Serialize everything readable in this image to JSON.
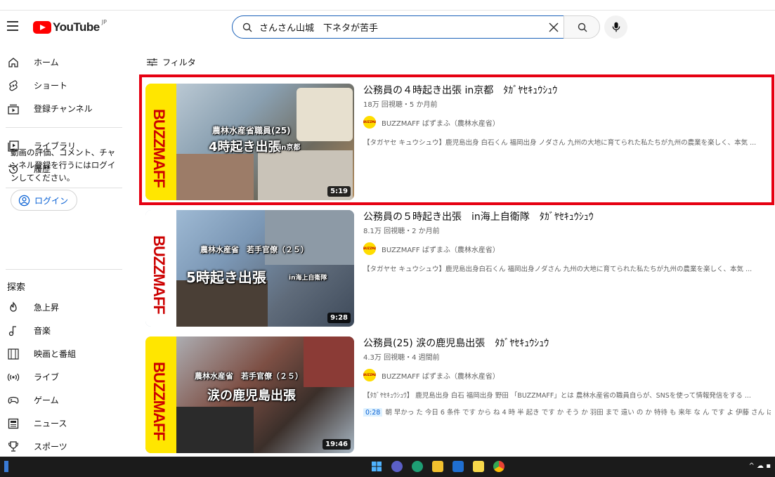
{
  "header": {
    "logo_text": "YouTube",
    "logo_region": "JP",
    "search_value": "さんさん山城　下ネタが苦手"
  },
  "sidebar": {
    "items": [
      {
        "label": "ホーム",
        "icon": "home-icon"
      },
      {
        "label": "ショート",
        "icon": "shorts-icon"
      },
      {
        "label": "登録チャンネル",
        "icon": "subscriptions-icon"
      },
      {
        "label": "ライブラリ",
        "icon": "library-icon"
      },
      {
        "label": "履歴",
        "icon": "history-icon"
      }
    ],
    "signin_prompt": "動画の評価、コメント、チャンネル登録を行うにはログインしてください。",
    "login_label": "ログイン",
    "explore_heading": "探索",
    "explore_items": [
      {
        "label": "急上昇",
        "icon": "trending-icon"
      },
      {
        "label": "音楽",
        "icon": "music-icon"
      },
      {
        "label": "映画と番組",
        "icon": "movies-icon"
      },
      {
        "label": "ライブ",
        "icon": "live-icon"
      },
      {
        "label": "ゲーム",
        "icon": "gaming-icon"
      },
      {
        "label": "ニュース",
        "icon": "news-icon"
      },
      {
        "label": "スポーツ",
        "icon": "sports-icon"
      }
    ]
  },
  "filter_label": "フィルタ",
  "results": [
    {
      "title": "公務員の４時起き出張 in京都　ﾀｶﾞﾔｾｷｭｳｼｭｳ",
      "stats": "18万 回視聴・5 か月前",
      "channel": "BUZZMAFF ばずまふ（農林水産省）",
      "description": "【タガヤセ キュウシュウ】鹿児島出身 白石くん 福岡出身 ノダさん 九州の大地に育てられた私たちが九州の農業を楽しく、本気 ...",
      "duration": "5:19",
      "thumb_line1": "農林水産省職員(25)",
      "thumb_line2": "4時起き出張",
      "thumb_line3": "in京都"
    },
    {
      "title": "公務員の５時起き出張　in海上自衛隊　ﾀｶﾞﾔｾｷｭｳｼｭｳ",
      "stats": "8.1万 回視聴・2 か月前",
      "channel": "BUZZMAFF ばずまふ（農林水産省）",
      "description": "【タガヤセ キュウシュウ】鹿児島出身白石くん 福岡出身ノダさん 九州の大地に育てられた私たちが九州の農業を楽しく、本気 ...",
      "duration": "9:28",
      "thumb_line1": "農林水産省　若手官僚（２５）",
      "thumb_line2": "5時起き出張",
      "thumb_line3": "in海上自衛隊"
    },
    {
      "title": "公務員(25) 涙の鹿児島出張　ﾀｶﾞﾔｾｷｭｳｼｭｳ",
      "stats": "4.3万 回視聴・4 週間前",
      "channel": "BUZZMAFF ばずまふ（農林水産省）",
      "description": "【ﾀｶﾞﾔｾｷｭｳｼｭｳ】 鹿児島出身 白石 福岡出身 野田 「BUZZMAFF」とは 農林水産省の職員自らが、SNSを使って情報発信をする ...",
      "chapter_time": "0:28",
      "chapter_text": "朝 早かっ た 今日 6 条件 です から ね 4 時 半 起き です か そう か 羽田 まで 遠い の か 特待 も 来年 な ん です よ 伊藤 さん は",
      "duration": "19:46",
      "thumb_line1": "農林水産省　若手官僚（２５）",
      "thumb_line2": "涙の鹿児島出張",
      "thumb_line3": ""
    }
  ],
  "thumb_brand": "BUZZMAFF",
  "colors": {
    "youtube_red": "#ff0000",
    "highlight_red": "#e60012",
    "link_blue": "#065fd4",
    "brand_yellow": "#ffe600"
  }
}
